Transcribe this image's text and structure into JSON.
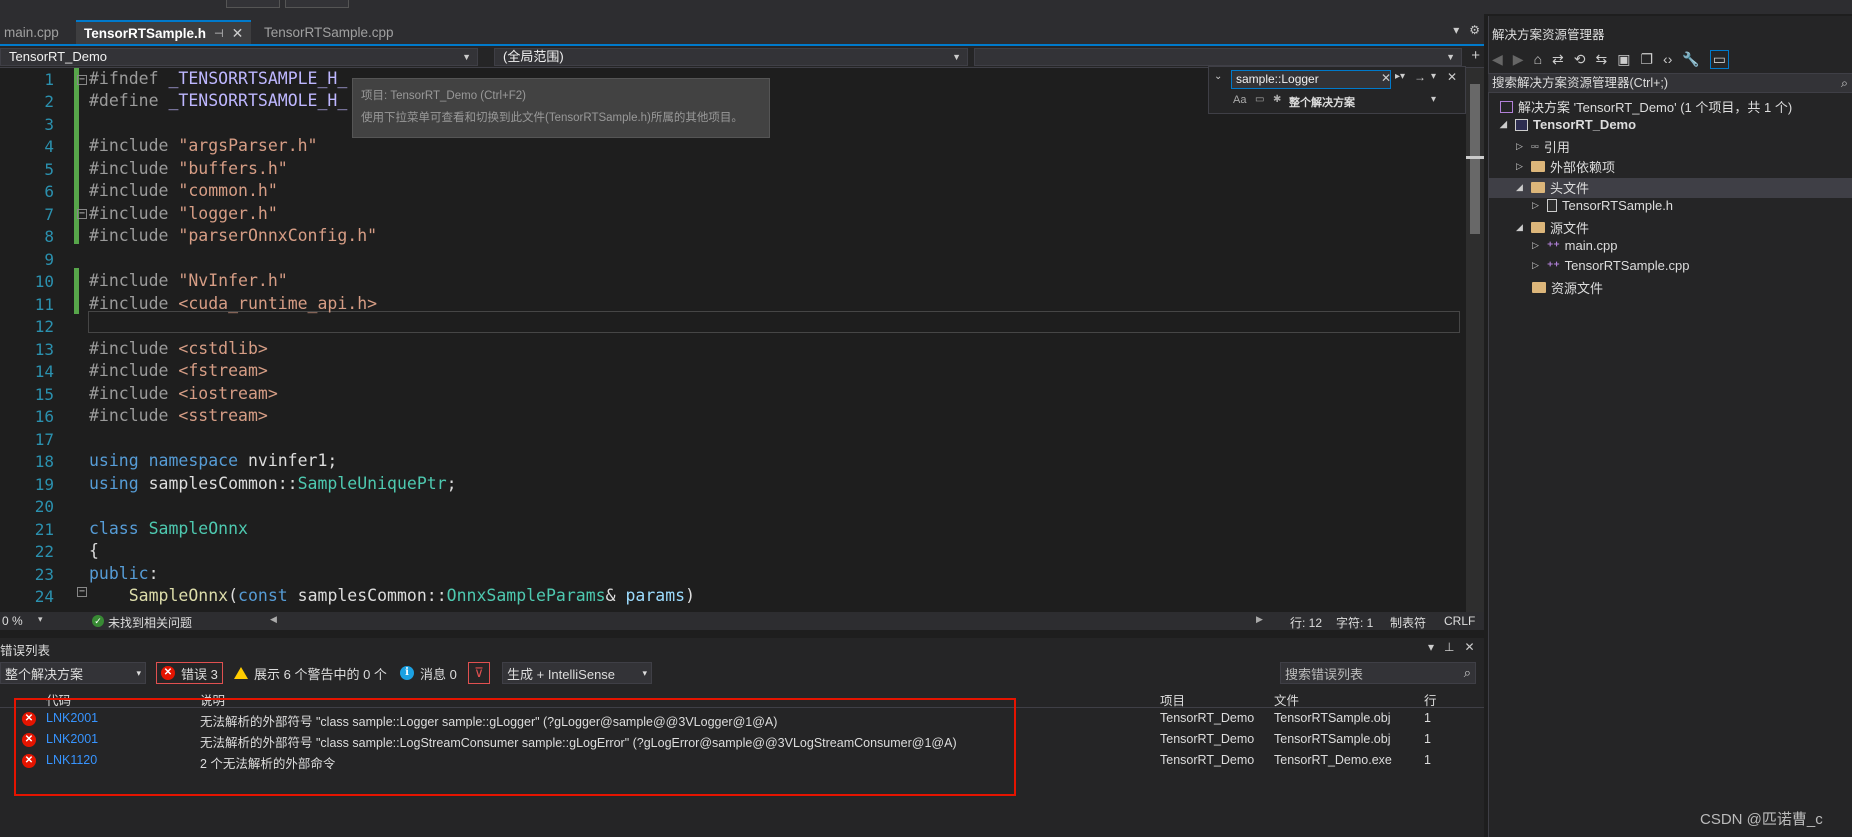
{
  "tabs": [
    {
      "label": "main.cpp",
      "active": false
    },
    {
      "label": "TensorRTSample.h",
      "active": true
    },
    {
      "label": "TensorRTSample.cpp",
      "active": false
    }
  ],
  "nav": {
    "project": "TensorRT_Demo",
    "scope": "(全局范围)"
  },
  "tooltip": {
    "line1": "项目: TensorRT_Demo (Ctrl+F2)",
    "line2": "使用下拉菜单可查看和切换到此文件(TensorRTSample.h)所属的其他项目。"
  },
  "find": {
    "value": "sample::Logger",
    "option_aa": "Aa",
    "scope": "整个解决方案"
  },
  "code": {
    "line_numbers": [
      "1",
      "2",
      "3",
      "4",
      "5",
      "6",
      "7",
      "8",
      "9",
      "10",
      "11",
      "12",
      "13",
      "14",
      "15",
      "16",
      "17",
      "18",
      "19",
      "20",
      "21",
      "22",
      "23",
      "24"
    ],
    "lines": [
      "#ifndef _TENSORRTSAMPLE_H_",
      "#define _TENSORRTSAMOLE_H_",
      "",
      "#include \"argsParser.h\"",
      "#include \"buffers.h\"",
      "#include \"common.h\"",
      "#include \"logger.h\"",
      "#include \"parserOnnxConfig.h\"",
      "",
      "#include \"NvInfer.h\"",
      "#include <cuda_runtime_api.h>",
      "",
      "#include <cstdlib>",
      "#include <fstream>",
      "#include <iostream>",
      "#include <sstream>",
      "",
      "using namespace nvinfer1;",
      "using samplesCommon::SampleUniquePtr;",
      "",
      "class SampleOnnx",
      "{",
      "public:",
      "    SampleOnnx(const samplesCommon::OnnxSampleParams& params)"
    ]
  },
  "editor_status": {
    "zoom": "0 %",
    "issues": "未找到相关问题",
    "line": "行: 12",
    "char": "字符: 1",
    "tabs": "制表符",
    "eol": "CRLF"
  },
  "error_list": {
    "title": "错误列表",
    "scope": "整个解决方案",
    "errors_label": "错误 3",
    "warnings_label": "展示 6 个警告中的 0 个",
    "messages_label": "消息 0",
    "build_filter": "生成 + IntelliSense",
    "search_placeholder": "搜索错误列表",
    "columns": {
      "code": "代码",
      "desc": "说明",
      "project": "项目",
      "file": "文件",
      "line": "行"
    },
    "rows": [
      {
        "code": "LNK2001",
        "desc": "无法解析的外部符号 \"class sample::Logger sample::gLogger\" (?gLogger@sample@@3VLogger@1@A)",
        "project": "TensorRT_Demo",
        "file": "TensorRTSample.obj",
        "line": "1"
      },
      {
        "code": "LNK2001",
        "desc": "无法解析的外部符号 \"class sample::LogStreamConsumer sample::gLogError\" (?gLogError@sample@@3VLogStreamConsumer@1@A)",
        "project": "TensorRT_Demo",
        "file": "TensorRTSample.obj",
        "line": "1"
      },
      {
        "code": "LNK1120",
        "desc": "2 个无法解析的外部命令",
        "project": "TensorRT_Demo",
        "file": "TensorRT_Demo.exe",
        "line": "1"
      }
    ]
  },
  "solution_explorer": {
    "title": "解决方案资源管理器",
    "search_placeholder": "搜索解决方案资源管理器(Ctrl+;)",
    "solution_label": "解决方案 'TensorRT_Demo' (1 个项目，共 1 个)",
    "project_label": "TensorRT_Demo",
    "items": {
      "references": "引用",
      "external": "外部依赖项",
      "headers": "头文件",
      "header_file": "TensorRTSample.h",
      "sources": "源文件",
      "main": "main.cpp",
      "source_file": "TensorRTSample.cpp",
      "resources": "资源文件"
    }
  },
  "watermark": "CSDN @匹诺曹_c",
  "colors": {
    "accent": "#007acc",
    "error": "#e51400",
    "keyword": "#569cd6",
    "string": "#d69d85",
    "type": "#4ec9b0"
  }
}
